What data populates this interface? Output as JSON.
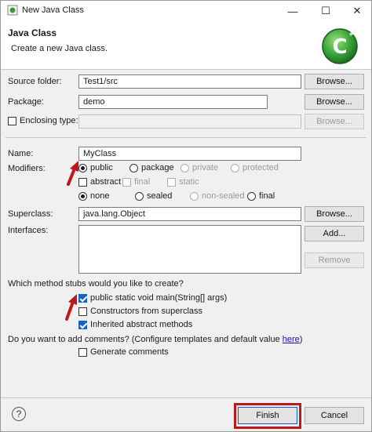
{
  "window": {
    "title": "New Java Class",
    "minimize": "—",
    "maximize": "☐",
    "close": "✕",
    "icon": "java-class-icon"
  },
  "banner": {
    "title": "Java Class",
    "subtitle": "Create a new Java class.",
    "logo": "class-c-logo"
  },
  "form": {
    "source_folder": {
      "label": "Source folder:",
      "value": "Test1/src",
      "button": "Browse..."
    },
    "package": {
      "label": "Package:",
      "value": "demo",
      "button": "Browse..."
    },
    "enclosing": {
      "label": "Enclosing type:",
      "value": "",
      "button": "Browse..."
    },
    "name": {
      "label": "Name:",
      "value": "MyClass"
    },
    "modifiers": {
      "label": "Modifiers:",
      "access": [
        "public",
        "package",
        "private",
        "protected"
      ],
      "other": [
        "abstract",
        "final",
        "static"
      ],
      "sealed": [
        "none",
        "sealed",
        "non-sealed",
        "final"
      ]
    },
    "superclass": {
      "label": "Superclass:",
      "value": "java.lang.Object",
      "button": "Browse..."
    },
    "interfaces": {
      "label": "Interfaces:",
      "add": "Add...",
      "remove": "Remove"
    },
    "stubs": {
      "question": "Which method stubs would you like to create?",
      "items": [
        "public static void main(String[] args)",
        "Constructors from superclass",
        "Inherited abstract methods"
      ],
      "checked": [
        true,
        false,
        true
      ]
    },
    "comments": {
      "question_prefix": "Do you want to add comments? (Configure templates and default value ",
      "link": "here",
      "question_suffix": ")",
      "checkbox": "Generate comments"
    }
  },
  "footer": {
    "help": "?",
    "finish": "Finish",
    "cancel": "Cancel"
  },
  "colors": {
    "accent": "#1565c0",
    "annotation": "#c0161e"
  }
}
